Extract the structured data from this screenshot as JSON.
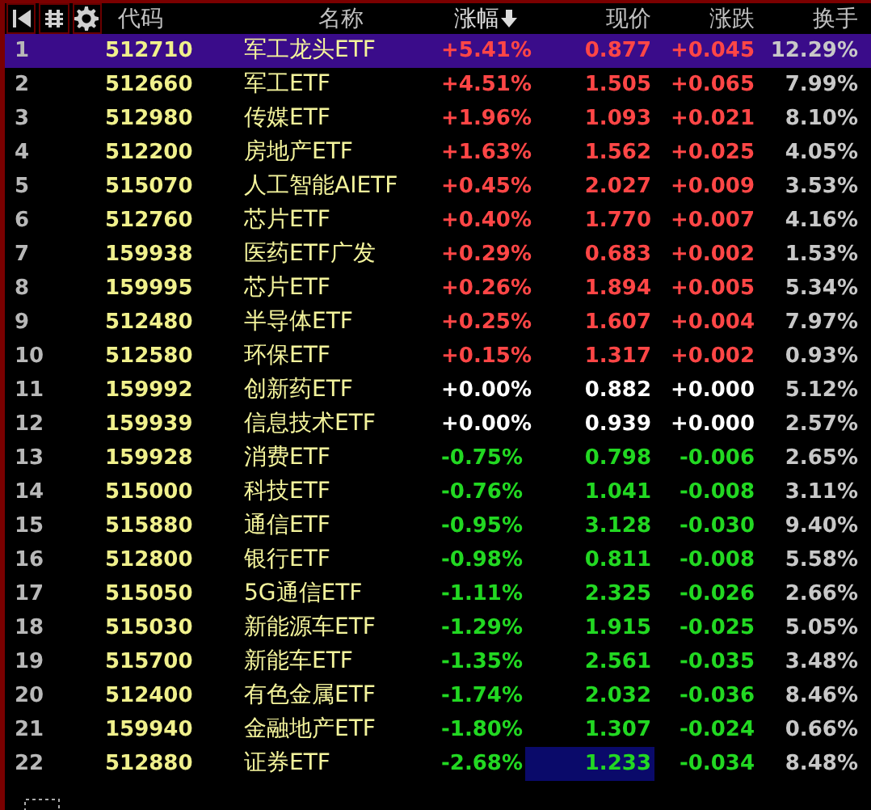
{
  "header": {
    "columns": [
      {
        "label": "代码",
        "sorted": false
      },
      {
        "label": "名称",
        "sorted": false
      },
      {
        "label": "涨幅",
        "sorted": true
      },
      {
        "label": "现价",
        "sorted": false
      },
      {
        "label": "涨跌",
        "sorted": false
      },
      {
        "label": "换手",
        "sorted": false
      }
    ]
  },
  "rows": [
    {
      "index": "1",
      "code": "512710",
      "name": "军工龙头ETF",
      "change_pct": "+5.41%",
      "price": "0.877",
      "change": "+0.045",
      "turnover": "12.29%",
      "kind": "up",
      "selected": true,
      "price_focused": false
    },
    {
      "index": "2",
      "code": "512660",
      "name": "军工ETF",
      "change_pct": "+4.51%",
      "price": "1.505",
      "change": "+0.065",
      "turnover": "7.99%",
      "kind": "up",
      "selected": false,
      "price_focused": false
    },
    {
      "index": "3",
      "code": "512980",
      "name": "传媒ETF",
      "change_pct": "+1.96%",
      "price": "1.093",
      "change": "+0.021",
      "turnover": "8.10%",
      "kind": "up",
      "selected": false,
      "price_focused": false
    },
    {
      "index": "4",
      "code": "512200",
      "name": "房地产ETF",
      "change_pct": "+1.63%",
      "price": "1.562",
      "change": "+0.025",
      "turnover": "4.05%",
      "kind": "up",
      "selected": false,
      "price_focused": false
    },
    {
      "index": "5",
      "code": "515070",
      "name": "人工智能AIETF",
      "change_pct": "+0.45%",
      "price": "2.027",
      "change": "+0.009",
      "turnover": "3.53%",
      "kind": "up",
      "selected": false,
      "price_focused": false
    },
    {
      "index": "6",
      "code": "512760",
      "name": "芯片ETF",
      "change_pct": "+0.40%",
      "price": "1.770",
      "change": "+0.007",
      "turnover": "4.16%",
      "kind": "up",
      "selected": false,
      "price_focused": false
    },
    {
      "index": "7",
      "code": "159938",
      "name": "医药ETF广发",
      "change_pct": "+0.29%",
      "price": "0.683",
      "change": "+0.002",
      "turnover": "1.53%",
      "kind": "up",
      "selected": false,
      "price_focused": false
    },
    {
      "index": "8",
      "code": "159995",
      "name": "芯片ETF",
      "change_pct": "+0.26%",
      "price": "1.894",
      "change": "+0.005",
      "turnover": "5.34%",
      "kind": "up",
      "selected": false,
      "price_focused": false
    },
    {
      "index": "9",
      "code": "512480",
      "name": "半导体ETF",
      "change_pct": "+0.25%",
      "price": "1.607",
      "change": "+0.004",
      "turnover": "7.97%",
      "kind": "up",
      "selected": false,
      "price_focused": false
    },
    {
      "index": "10",
      "code": "512580",
      "name": "环保ETF",
      "change_pct": "+0.15%",
      "price": "1.317",
      "change": "+0.002",
      "turnover": "0.93%",
      "kind": "up",
      "selected": false,
      "price_focused": false
    },
    {
      "index": "11",
      "code": "159992",
      "name": "创新药ETF",
      "change_pct": "+0.00%",
      "price": "0.882",
      "change": "+0.000",
      "turnover": "5.12%",
      "kind": "flat",
      "selected": false,
      "price_focused": false
    },
    {
      "index": "12",
      "code": "159939",
      "name": "信息技术ETF",
      "change_pct": "+0.00%",
      "price": "0.939",
      "change": "+0.000",
      "turnover": "2.57%",
      "kind": "flat",
      "selected": false,
      "price_focused": false
    },
    {
      "index": "13",
      "code": "159928",
      "name": "消费ETF",
      "change_pct": "-0.75%",
      "price": "0.798",
      "change": "-0.006",
      "turnover": "2.65%",
      "kind": "down",
      "selected": false,
      "price_focused": false
    },
    {
      "index": "14",
      "code": "515000",
      "name": "科技ETF",
      "change_pct": "-0.76%",
      "price": "1.041",
      "change": "-0.008",
      "turnover": "3.11%",
      "kind": "down",
      "selected": false,
      "price_focused": false
    },
    {
      "index": "15",
      "code": "515880",
      "name": "通信ETF",
      "change_pct": "-0.95%",
      "price": "3.128",
      "change": "-0.030",
      "turnover": "9.40%",
      "kind": "down",
      "selected": false,
      "price_focused": false
    },
    {
      "index": "16",
      "code": "512800",
      "name": "银行ETF",
      "change_pct": "-0.98%",
      "price": "0.811",
      "change": "-0.008",
      "turnover": "5.58%",
      "kind": "down",
      "selected": false,
      "price_focused": false
    },
    {
      "index": "17",
      "code": "515050",
      "name": "5G通信ETF",
      "change_pct": "-1.11%",
      "price": "2.325",
      "change": "-0.026",
      "turnover": "2.66%",
      "kind": "down",
      "selected": false,
      "price_focused": false
    },
    {
      "index": "18",
      "code": "515030",
      "name": "新能源车ETF",
      "change_pct": "-1.29%",
      "price": "1.915",
      "change": "-0.025",
      "turnover": "5.05%",
      "kind": "down",
      "selected": false,
      "price_focused": false
    },
    {
      "index": "19",
      "code": "515700",
      "name": "新能车ETF",
      "change_pct": "-1.35%",
      "price": "2.561",
      "change": "-0.035",
      "turnover": "3.48%",
      "kind": "down",
      "selected": false,
      "price_focused": false
    },
    {
      "index": "20",
      "code": "512400",
      "name": "有色金属ETF",
      "change_pct": "-1.74%",
      "price": "2.032",
      "change": "-0.036",
      "turnover": "8.46%",
      "kind": "down",
      "selected": false,
      "price_focused": false
    },
    {
      "index": "21",
      "code": "159940",
      "name": "金融地产ETF",
      "change_pct": "-1.80%",
      "price": "1.307",
      "change": "-0.024",
      "turnover": "0.66%",
      "kind": "down",
      "selected": false,
      "price_focused": false
    },
    {
      "index": "22",
      "code": "512880",
      "name": "证券ETF",
      "change_pct": "-2.68%",
      "price": "1.233",
      "change": "-0.034",
      "turnover": "8.48%",
      "kind": "down",
      "selected": false,
      "price_focused": true
    }
  ]
}
